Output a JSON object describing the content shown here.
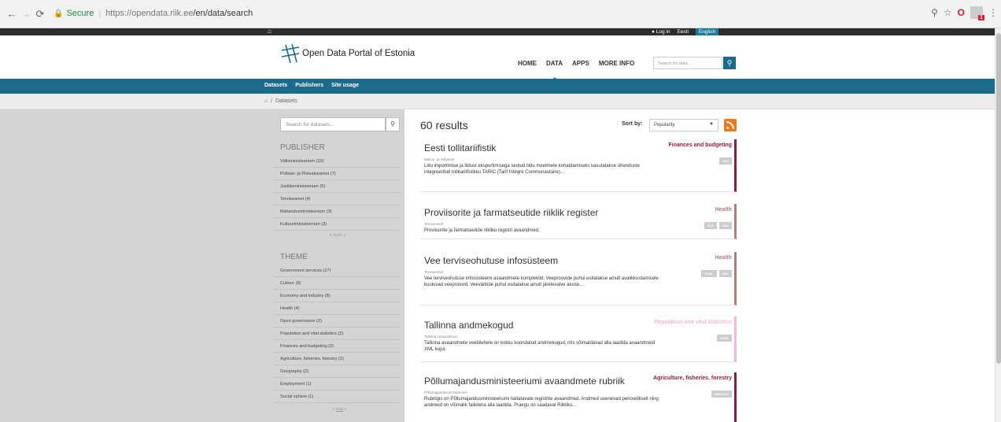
{
  "browser": {
    "secure_label": "Secure",
    "url_host": "https://opendata.riik.ee",
    "url_path": "/en/data/search"
  },
  "topbar": {
    "login": "Log in",
    "lang_et": "Eesti",
    "lang_en": "English"
  },
  "header": {
    "site_title": "Open Data Portal of Estonia",
    "nav": [
      "HOME",
      "DATA",
      "APPS",
      "MORE INFO"
    ],
    "search_placeholder": "Search for data..."
  },
  "subnav": [
    "Datasets",
    "Publishers",
    "Site usage"
  ],
  "breadcrumb": {
    "sep": "/",
    "current": "Datasets"
  },
  "sidebar": {
    "search_placeholder": "Search for datasets...",
    "publisher_heading": "PUBLISHER",
    "publishers": [
      "Välisministeerium (10)",
      "Politsei- ja Piirivalveamet (7)",
      "Justiitsministeerium (5)",
      "Terviseamet (4)",
      "Rahandusministeerium (3)",
      "Kultuuriministeerium (3)"
    ],
    "more_label": "more",
    "theme_heading": "THEME",
    "themes": [
      "Government services (27)",
      "Culture (9)",
      "Economy and industry (8)",
      "Health (4)",
      "Open governance (2)",
      "Population and vital statistics (2)",
      "Finances and budgeting (2)",
      "Agriculture, fisheries, forestry (2)",
      "Geography (2)",
      "Employment (1)",
      "Social sphere (1)"
    ],
    "less_label": "less"
  },
  "main": {
    "results_count": "60 results",
    "sort_label": "Sort by:",
    "sort_value": "Popularity",
    "datasets": [
      {
        "title": "Eesti tollitariifistik",
        "category": "Finances and budgeting",
        "color": "#8c1d40",
        "publisher": "Maksu- ja Tolliamet",
        "description": "Liitu importimise ja liidust eksportimisega seotud liidu meetmete kohaldamiseks kasutatakse ühenduste integreeritud tollitariifistikku TARIC (Tarif Intégré Communautaire)...",
        "formats": [
          "CSV"
        ]
      },
      {
        "title": "Proviisorite ja farmatseutide riiklik register",
        "category": "Health",
        "color": "#b07d7d",
        "publisher": "Terviseamet",
        "description": "Proviisorite ja farmatseutide riikliku registri avaandmed.",
        "formats": [
          "XLS",
          "XML"
        ]
      },
      {
        "title": "Vee terviseohutuse infosüsteem",
        "category": "Health",
        "color": "#b07d7d",
        "publisher": "Terviseamet",
        "description": "Vee terviseohutuse infosüsteemi avaandmete komplektid. Veeproovide puhul esitatakse ainult avalikkustamisele kuuluvad veeproovid. Veevärkide puhul esitatakse ainult järelevalve aluste...",
        "formats": [
          "HTML",
          "XML"
        ]
      },
      {
        "title": "Tallinna andmekogud",
        "category": "Population and vital statistics",
        "color": "#f0b8e0",
        "publisher": "Tallinna Linnavalitsus",
        "description": "Tallinna avaandmete veebilehele on kokku koondatud andmekogud, mis võimaldavad alla laadida avaandmeid XML kujul.",
        "formats": [
          "HTML"
        ]
      },
      {
        "title": "Põllumajandusministeeriumi avaandmete rubriik",
        "category": "Agriculture, fisheries, forestry",
        "color": "#8c1d40",
        "publisher": "Põllumajandusministeerium",
        "description": "Rubriigis on Põllumajandusministeeriumi hallatavate registrite avaandmed. Andmed uuenevad perioodiliselt ning andmeid on võimalik failidena alla laadida. Praegu on saadaval Riikliku...",
        "formats": [
          "WEBSITE"
        ]
      }
    ]
  }
}
